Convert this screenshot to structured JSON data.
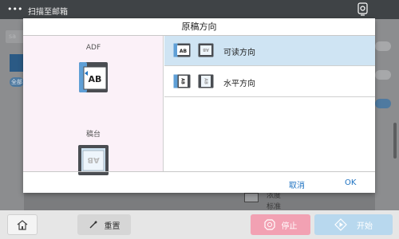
{
  "topbar": {
    "title": "扫描至邮箱",
    "menu_icon": "more-dots-icon",
    "tool_icon": "scanner-tool-icon"
  },
  "background": {
    "field_placeholder": "sa",
    "chip_label": "全部",
    "density_label": "浓度",
    "density_value": "标准"
  },
  "dialog": {
    "title": "原稿方向",
    "left": {
      "adf_label": "ADF",
      "platen_label": "稿台"
    },
    "options": [
      {
        "label": "可读方向",
        "selected": true
      },
      {
        "label": "水平方向",
        "selected": false
      }
    ],
    "cancel_label": "取消",
    "ok_label": "OK"
  },
  "bottombar": {
    "reset_label": "重置",
    "stop_label": "停止",
    "start_label": "开始"
  },
  "colors": {
    "selected_row": "#cfe4f3",
    "link": "#1f73c2",
    "stop": "#f2a1b3",
    "start": "#b8d8ee",
    "left_panel": "#fbf1f8"
  }
}
